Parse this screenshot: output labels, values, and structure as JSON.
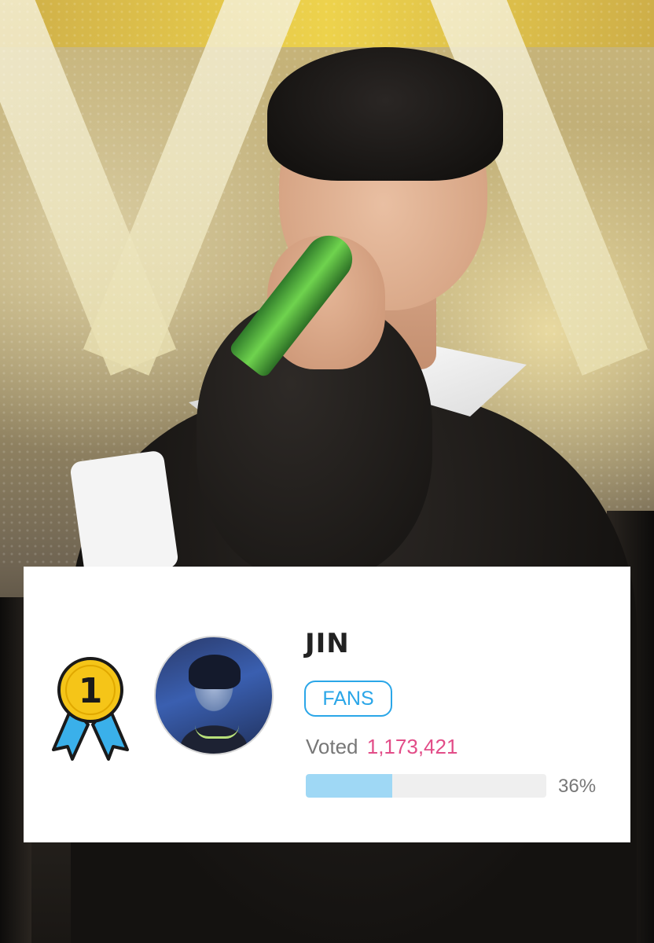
{
  "ranking": {
    "rank": "1",
    "name": "JIN",
    "badge": "FANS",
    "voted_label": "Voted",
    "vote_count": "1,173,421",
    "percent_label": "36%",
    "progress_fraction": 0.36
  },
  "icons": {
    "medal": "first-place-medal-icon"
  },
  "colors": {
    "badge_blue": "#2aa6e8",
    "vote_pink": "#e24d88",
    "progress_fill": "#9fd8f5",
    "medal_gold": "#f5c518",
    "ribbon_blue": "#3ab0ea"
  }
}
